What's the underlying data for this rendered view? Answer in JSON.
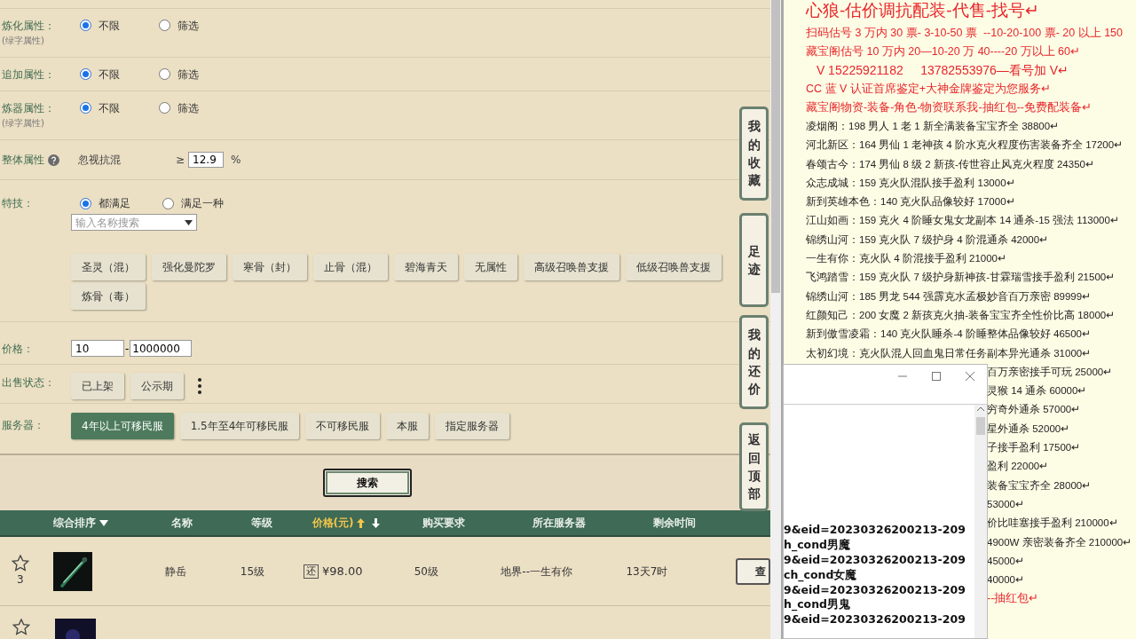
{
  "filters": [
    {
      "label": "炼化属性：",
      "note": "(绿字属性)",
      "options": [
        {
          "label": "不限",
          "selected": true
        },
        {
          "label": "筛选",
          "selected": false
        }
      ]
    },
    {
      "label": "追加属性：",
      "options": [
        {
          "label": "不限",
          "selected": true
        },
        {
          "label": "筛选",
          "selected": false
        }
      ]
    },
    {
      "label": "炼器属性：",
      "note": "(绿字属性)",
      "options": [
        {
          "label": "不限",
          "selected": true
        },
        {
          "label": "筛选",
          "selected": false
        }
      ]
    }
  ],
  "overall": {
    "label": "整体属性",
    "attribute": "忽视抗混",
    "operator": "≥",
    "value": "12.9",
    "unit": "%"
  },
  "skills": {
    "label": "特技：",
    "options": [
      {
        "label": "都满足",
        "selected": true
      },
      {
        "label": "满足一种",
        "selected": false
      }
    ],
    "search_placeholder": "输入名称搜索",
    "chips": [
      "圣灵（混）",
      "强化曼陀罗",
      "寒骨（封）",
      "止骨（混）",
      "碧海青天",
      "无属性",
      "高级召唤兽支援",
      "低级召唤兽支援",
      "炼骨（毒）"
    ]
  },
  "price": {
    "label": "价格：",
    "min": "10",
    "separator": "-",
    "max": "1000000"
  },
  "sale_status": {
    "label": "出售状态：",
    "options": [
      {
        "label": "已上架",
        "selected": false
      },
      {
        "label": "公示期",
        "selected": false
      }
    ]
  },
  "server": {
    "label": "服务器：",
    "options": [
      {
        "label": "4年以上可移民服",
        "selected": true
      },
      {
        "label": "1.5年至4年可移民服",
        "selected": false
      },
      {
        "label": "不可移民服",
        "selected": false
      },
      {
        "label": "本服",
        "selected": false
      },
      {
        "label": "指定服务器",
        "selected": false
      }
    ]
  },
  "search_button": "搜索",
  "table": {
    "columns": [
      {
        "label": "综合排序",
        "kind": "menu"
      },
      {
        "label": "名称",
        "kind": "plain"
      },
      {
        "label": "等级",
        "kind": "plain"
      },
      {
        "label": "价格(元)",
        "kind": "sorted"
      },
      {
        "label": "购买要求",
        "kind": "plain"
      },
      {
        "label": "所在服务器",
        "kind": "plain"
      },
      {
        "label": "剩余时间",
        "kind": "plain"
      }
    ],
    "rows": [
      {
        "favorites": "3",
        "name": "静岳",
        "level": "15级",
        "bargain": "还",
        "price": "¥98.00",
        "requirement": "50级",
        "server": "地界--一生有你",
        "time": "13天7时",
        "action": "查"
      }
    ]
  },
  "side_tabs": [
    "我的收藏",
    "足迹",
    "我的还价",
    "返回顶部"
  ],
  "document": {
    "lines": [
      {
        "kind": "headline",
        "text": "心狼-估价调抗配装-代售-找号↵"
      },
      {
        "kind": "red",
        "text": "扫码估号 3 万内 30 票- 3-10-50 票  --10-20-100 票- 20 以上 150"
      },
      {
        "kind": "red",
        "text": "藏宝阁估号 10 万内 20—10-20 万 40----20 万以上 60↵"
      },
      {
        "kind": "red-large",
        "text": " V 15225921182     13782553976—看号加 V↵"
      },
      {
        "kind": "red",
        "text": "CC 蓝 V 认证首席鉴定+大神金牌鉴定为您服务↵"
      },
      {
        "kind": "red",
        "text": "藏宝阁物资-装备-角色-物资联系我-抽红包--免费配装备↵"
      },
      {
        "kind": "normal",
        "text": "凌烟阁：198 男人 1 老 1 新全满装备宝宝齐全 38800↵"
      },
      {
        "kind": "normal",
        "text": "河北新区：164 男仙 1 老神孩 4 阶水克火程度伤害装备齐全 17200↵"
      },
      {
        "kind": "normal",
        "text": "春颂古今：174 男仙 8 级 2 新孩-传世容止风克火程度 24350↵"
      },
      {
        "kind": "normal",
        "text": "众志成城：159 克火队混队接手盈利 13000↵"
      },
      {
        "kind": "normal",
        "text": "新到英雄本色：140 克火队品像较好 17000↵"
      },
      {
        "kind": "normal",
        "text": "江山如画：159 克火 4 阶睡女鬼女龙副本 14 通杀-15 强法 113000↵"
      },
      {
        "kind": "normal",
        "text": "锦绣山河：159 克火队 7 级护身 4 阶混通杀 42000↵"
      },
      {
        "kind": "normal",
        "text": "一生有你：克火队 4 阶混接手盈利 21000↵"
      },
      {
        "kind": "normal",
        "text": "飞鸿踏雪：159 克火队 7 级护身新神孩-甘霖瑞雪接手盈利 21500↵"
      },
      {
        "kind": "normal",
        "text": "锦绣山河：185 男龙 544 强霹克水孟极妙音百万亲密 89999↵"
      },
      {
        "kind": "normal",
        "text": "红颜知己：200 女魔 2 新孩克火抽-装备宝宝齐全性价比高 18000↵"
      },
      {
        "kind": "normal",
        "text": "新到傲雪凌霜：140 克火队睡杀-4 阶睡整体品像较好 46500↵"
      },
      {
        "kind": "normal",
        "text": "太初幻境：克火队混人回血鬼日常任务副本异光通杀 31000↵"
      },
      {
        "kind": "partial",
        "text": "百万亲密接手可玩 25000↵"
      },
      {
        "kind": "partial",
        "text": "灵猴 14 通杀 60000↵"
      },
      {
        "kind": "partial",
        "text": "穷奇外通杀 57000↵"
      },
      {
        "kind": "partial",
        "text": "星外通杀 52000↵"
      },
      {
        "kind": "partial",
        "text": "子接手盈利 17500↵"
      },
      {
        "kind": "partial",
        "text": "盈利 22000↵"
      },
      {
        "kind": "partial",
        "text": "装备宝宝齐全 28000↵"
      },
      {
        "kind": "partial",
        "text": "53000↵"
      },
      {
        "kind": "partial",
        "text": "价比哇塞接手盈利 210000↵"
      },
      {
        "kind": "partial",
        "text": "4900W 亲密装备齐全 210000↵"
      },
      {
        "kind": "partial",
        "text": "45000↵"
      },
      {
        "kind": "partial",
        "text": "40000↵"
      },
      {
        "kind": "partial-red",
        "text": "--抽红包↵"
      }
    ]
  },
  "popup_window": {
    "lines": [
      "9&eid=20230326200213-209",
      "h_cond男魔",
      "9&eid=20230326200213-209",
      "ch_cond女魔",
      "9&eid=20230326200213-209",
      "h_cond男鬼",
      "9&eid=20230326200213-209"
    ]
  }
}
